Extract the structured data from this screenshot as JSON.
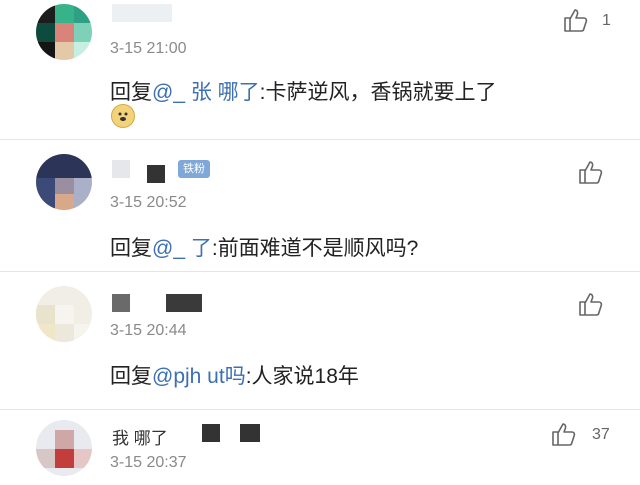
{
  "comments": [
    {
      "author": "",
      "badge": "",
      "time": "3-15 21:00",
      "reply_prefix": "回复",
      "mention": "@_ 张 哪了",
      "separator": ":",
      "text": "卡萨逆风，香锅就要上了",
      "like_count": "1",
      "emoji": "doge-emoji"
    },
    {
      "author": "",
      "badge": "铁粉",
      "time": "3-15 20:52",
      "reply_prefix": "回复",
      "mention": "@_ 了",
      "separator": ":",
      "text": "前面难道不是顺风吗?",
      "like_count": ""
    },
    {
      "author": "",
      "badge": "",
      "time": "3-15 20:44",
      "reply_prefix": "回复",
      "mention": "@pjh ut吗",
      "separator": ":",
      "text": "人家说18年",
      "like_count": ""
    },
    {
      "author": "我 哪了",
      "badge": "",
      "time": "3-15 20:37",
      "like_count": "37"
    }
  ],
  "colors": {
    "mention": "#3c6fb3",
    "badge": "#7fa8d8",
    "time": "#8a8a8a"
  },
  "icons": [
    "thumbs-up-icon",
    "doge-emoji"
  ]
}
